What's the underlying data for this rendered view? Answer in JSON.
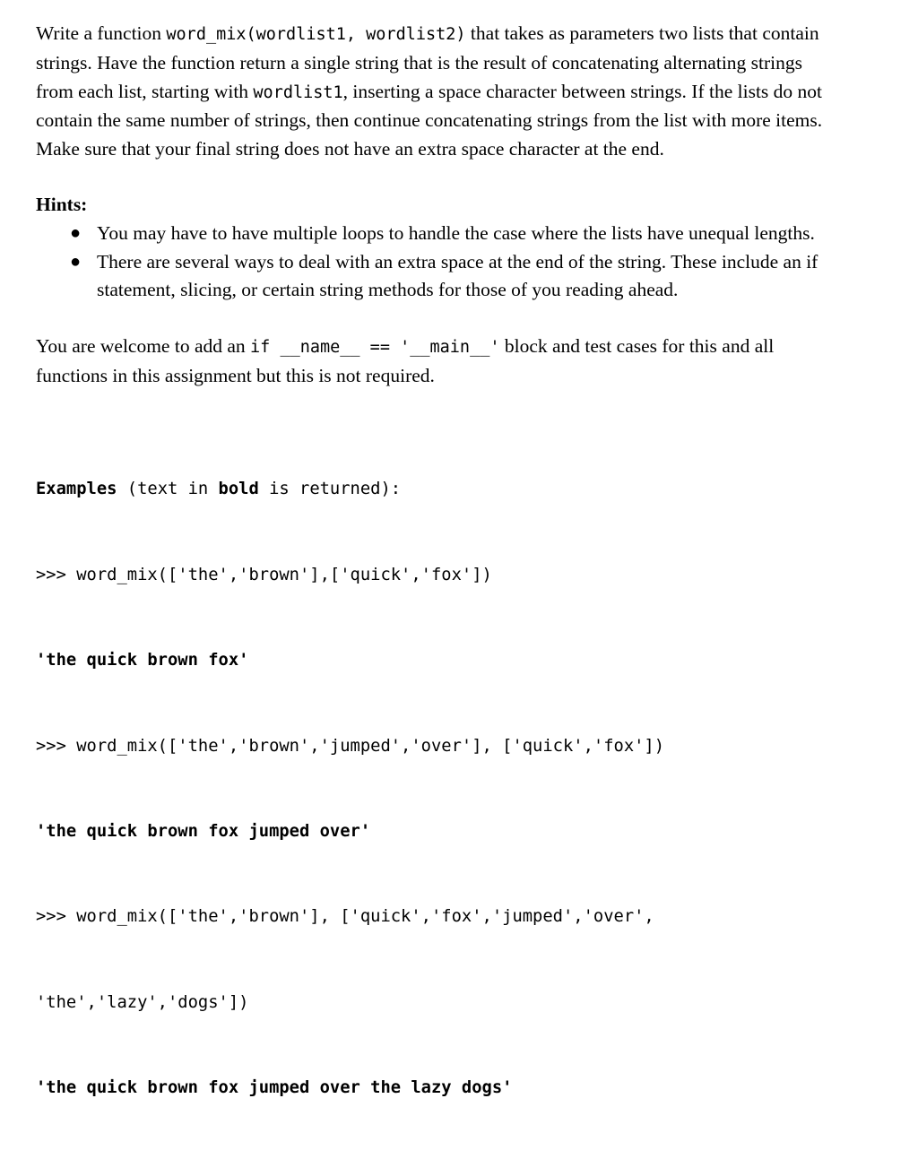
{
  "document": {
    "intro": {
      "segments": [
        {
          "type": "text",
          "value": "Write a function "
        },
        {
          "type": "code",
          "value": "word_mix(wordlist1, wordlist2)"
        },
        {
          "type": "text",
          "value": " that takes as parameters two lists that contain strings. Have the function return a single string that is the result of concatenating alternating strings from each list, starting with "
        },
        {
          "type": "code",
          "value": "wordlist1"
        },
        {
          "type": "text",
          "value": ", inserting a space character between strings. If the lists do not contain the same number of strings, then continue concatenating strings from the list with more items. Make sure that your final string does not have an extra space character at the end."
        }
      ],
      "part1": "Write a function ",
      "code1": "word_mix(wordlist1, wordlist2)",
      "part2": " that takes as parameters two lists that contain strings. Have the function return a single string that is the result of concatenating alternating strings from each list, starting with ",
      "code2": "wordlist1",
      "part3": ", inserting a space character between strings. If the lists do not contain the same number of strings, then continue concatenating strings from the list with more items. Make sure that your final string does not have an extra space character at the end."
    },
    "hints": {
      "heading": "Hints:",
      "bullet_glyph": "●",
      "items": [
        "You may have to have multiple loops to handle the case where the lists have unequal lengths.",
        "There are several ways to deal with an extra space at the end of the string.  These include an if statement, slicing, or certain string methods for those of you reading ahead."
      ]
    },
    "note": {
      "part1": "You are welcome to add an ",
      "code1": "if __name__ == '__main__'",
      "part2": " block and test cases for this and all functions in this assignment but this is not required."
    },
    "examples": {
      "heading_bold": "Examples",
      "heading_rest_a": " (text in ",
      "heading_bold_inner": "bold",
      "heading_rest_b": " is returned):",
      "lines": [
        {
          "text": ">>> word_mix(['the','brown'],['quick','fox'])",
          "bold": false
        },
        {
          "text": "'the quick brown fox'",
          "bold": true
        },
        {
          "text": ">>> word_mix(['the','brown','jumped','over'], ['quick','fox'])",
          "bold": false
        },
        {
          "text": "'the quick brown fox jumped over'",
          "bold": true
        },
        {
          "text": ">>> word_mix(['the','brown'], ['quick','fox','jumped','over',",
          "bold": false
        },
        {
          "text": "'the','lazy','dogs'])",
          "bold": false
        },
        {
          "text": "'the quick brown fox jumped over the lazy dogs'",
          "bold": true
        }
      ]
    }
  },
  "colors": {
    "background": "#ffffff",
    "text": "#000000"
  }
}
